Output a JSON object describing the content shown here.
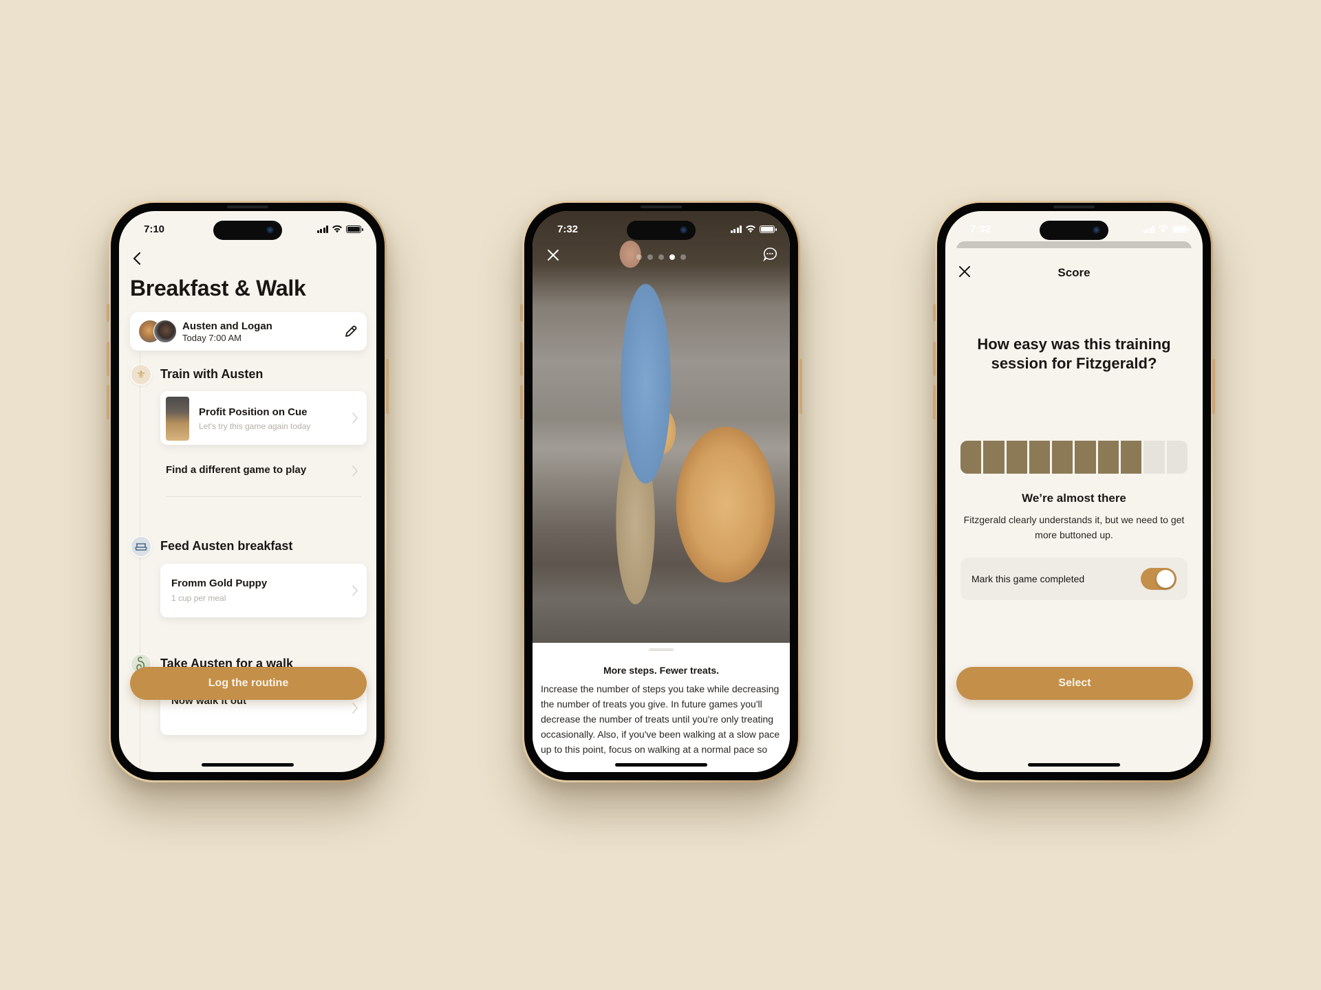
{
  "colors": {
    "background": "#ebe1cc",
    "accent": "#c48f49",
    "score_filled": "#8c7a57",
    "score_empty": "#e6e3dd"
  },
  "phones": {
    "routine": {
      "status": {
        "time": "7:10"
      },
      "back_icon": "chevron-left",
      "title": "Breakfast & Walk",
      "owner_card": {
        "names": "Austen and Logan",
        "time": "Today 7:00 AM",
        "edit_icon": "pencil"
      },
      "sections": [
        {
          "icon": "fleur-de-lis",
          "title": "Train with Austen",
          "card": {
            "title": "Profit Position on Cue",
            "subtitle": "Let's try this game again today"
          },
          "link": "Find a different game to play"
        },
        {
          "icon": "food-bowl",
          "title": "Feed Austen breakfast",
          "card": {
            "title": "Fromm Gold Puppy",
            "subtitle": "1 cup per meal"
          }
        },
        {
          "icon": "leash",
          "title": "Take Austen for a walk",
          "card": {
            "title": "Now walk it out"
          }
        }
      ],
      "cta": "Log the routine"
    },
    "game_detail": {
      "status": {
        "time": "7:32"
      },
      "close_icon": "close",
      "comment_icon": "chat-bubble",
      "pagination": {
        "total": 5,
        "active": 4
      },
      "sheet": {
        "title": "More steps. Fewer treats.",
        "body": "Increase the number of steps you take while decreasing the number of treats you give. In future games you'll decrease the number of treats until you're only treating occasionally. Also, if you've been walking at a slow pace up to this point, focus on walking at a normal pace so"
      }
    },
    "score": {
      "status": {
        "time": "7:32"
      },
      "close_icon": "close",
      "title": "Score",
      "question": "How easy was this training session for Fitzgerald?",
      "score": {
        "value": 8,
        "max": 10
      },
      "verdict": "We’re almost there",
      "verdict_detail": "Fitzgerald clearly understands it, but we need to get more buttoned up.",
      "toggle": {
        "label": "Mark this game completed",
        "on": true
      },
      "cta": "Select"
    }
  }
}
